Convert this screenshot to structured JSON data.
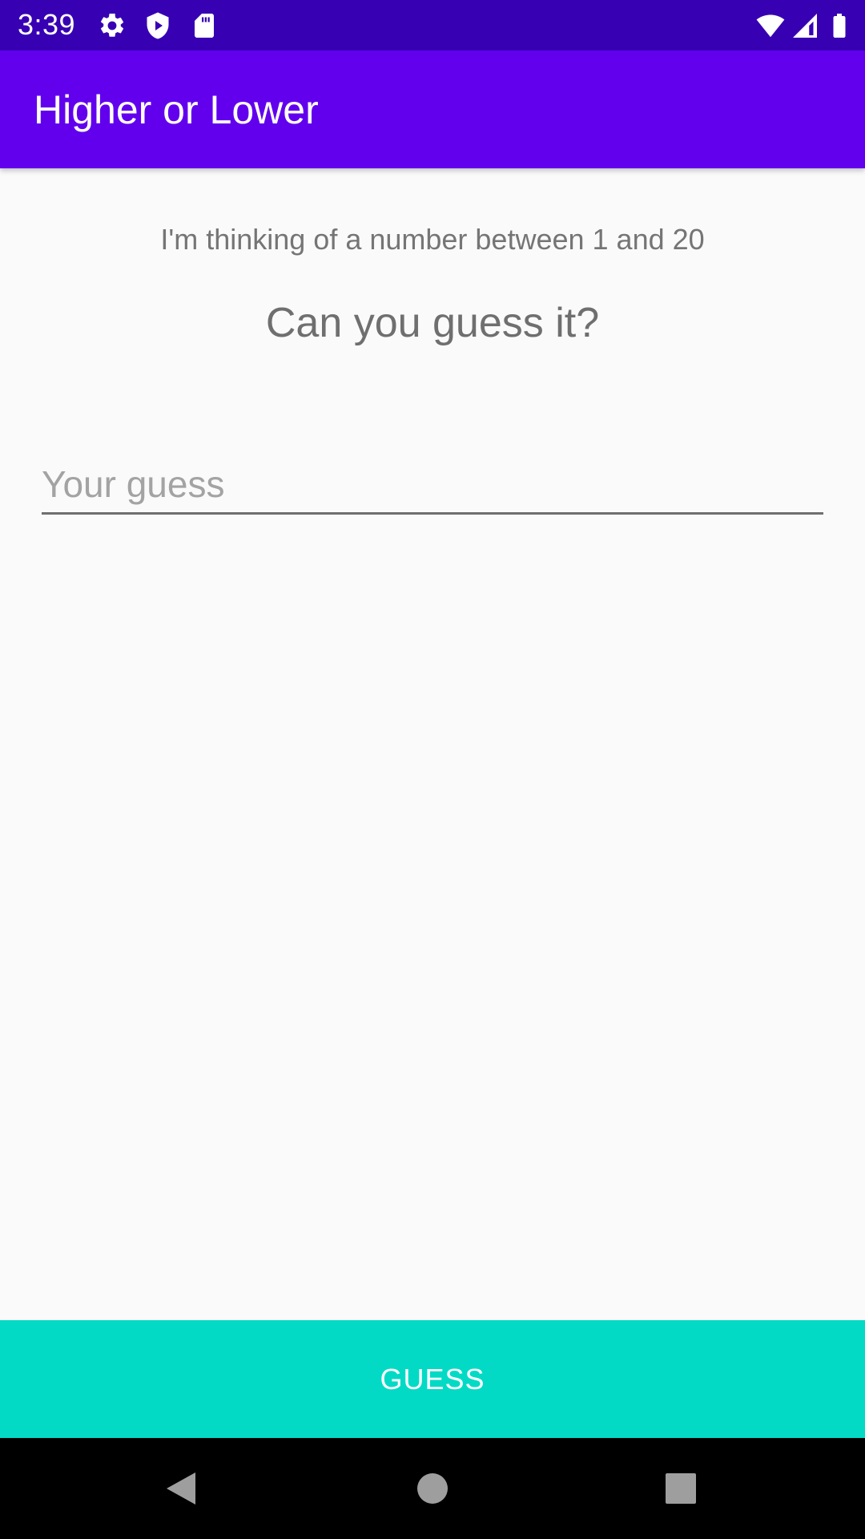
{
  "status_bar": {
    "time": "3:39",
    "icons": [
      "settings-icon",
      "shield-play-icon",
      "sd-card-icon",
      "wifi-icon",
      "cell-signal-icon",
      "battery-icon"
    ],
    "background": "#3700b3"
  },
  "app_bar": {
    "title": "Higher or Lower",
    "background": "#6200ee"
  },
  "main": {
    "subtitle": "I'm thinking of a number between 1 and 20",
    "prompt": "Can you guess it?",
    "guess_input": {
      "value": "",
      "placeholder": "Your guess"
    }
  },
  "guess_button": {
    "label": "GUESS",
    "background": "#03dac5"
  },
  "nav_bar": {
    "icons": [
      "back-icon",
      "home-icon",
      "recents-icon"
    ]
  }
}
